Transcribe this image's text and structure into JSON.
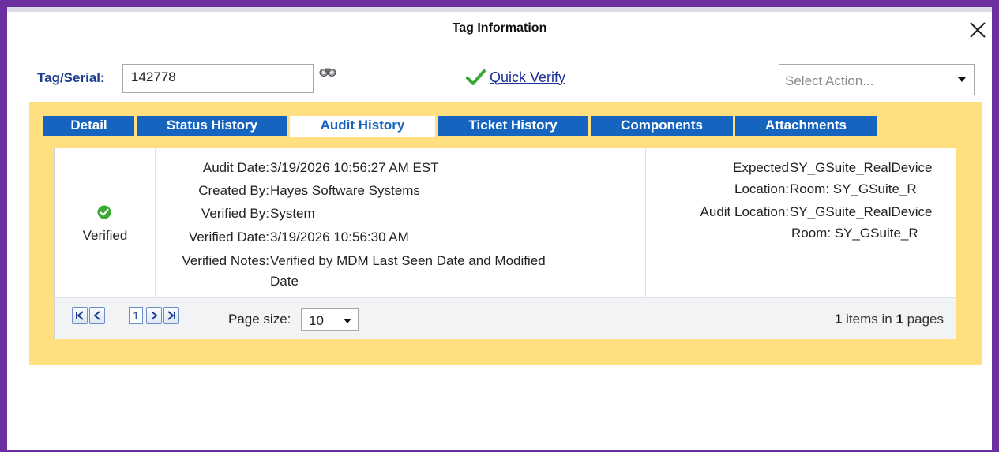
{
  "dialog": {
    "title": "Tag Information"
  },
  "tag": {
    "label": "Tag/Serial:",
    "value": "142778"
  },
  "quick_verify": {
    "label": "Quick Verify"
  },
  "action_select": {
    "placeholder": "Select Action..."
  },
  "tabs": [
    {
      "label": "Detail",
      "active": false
    },
    {
      "label": "Status History",
      "active": false
    },
    {
      "label": "Audit History",
      "active": true
    },
    {
      "label": "Ticket History",
      "active": false
    },
    {
      "label": "Components",
      "active": false
    },
    {
      "label": "Attachments",
      "active": false
    }
  ],
  "audit_record": {
    "status": "Verified",
    "details": [
      {
        "key": "Audit Date:",
        "value": "3/19/2026 10:56:27 AM EST"
      },
      {
        "key": "Created By:",
        "value": "Hayes Software Systems"
      },
      {
        "key": "Verified By:",
        "value": "System"
      },
      {
        "key": "Verified Date:",
        "value": "3/19/2026 10:56:30 AM"
      },
      {
        "key": "Verified Notes:",
        "value": "Verified by MDM Last Seen Date and Modified",
        "value_line2": "Date"
      }
    ],
    "locations": {
      "expected_key_line1": "Expected",
      "expected_key_line2": "Location:",
      "expected_value_line1": "SY_GSuite_RealDevice",
      "expected_value_line2": "Room: SY_GSuite_R",
      "audit_key": "Audit Location:",
      "audit_value_line1": "SY_GSuite_RealDevice",
      "audit_value_line2": "Room: SY_GSuite_R"
    }
  },
  "pager": {
    "current_page": "1",
    "page_size_label": "Page size:",
    "page_size": "10",
    "items_count": "1",
    "items_text": "items in",
    "pages_count": "1",
    "pages_text": "pages"
  },
  "colors": {
    "frame": "#6b2fa0",
    "panel": "#ffdf7f",
    "tab": "#1565c0",
    "label_blue": "#1c3d8f",
    "verified_green": "#3aaa35"
  }
}
